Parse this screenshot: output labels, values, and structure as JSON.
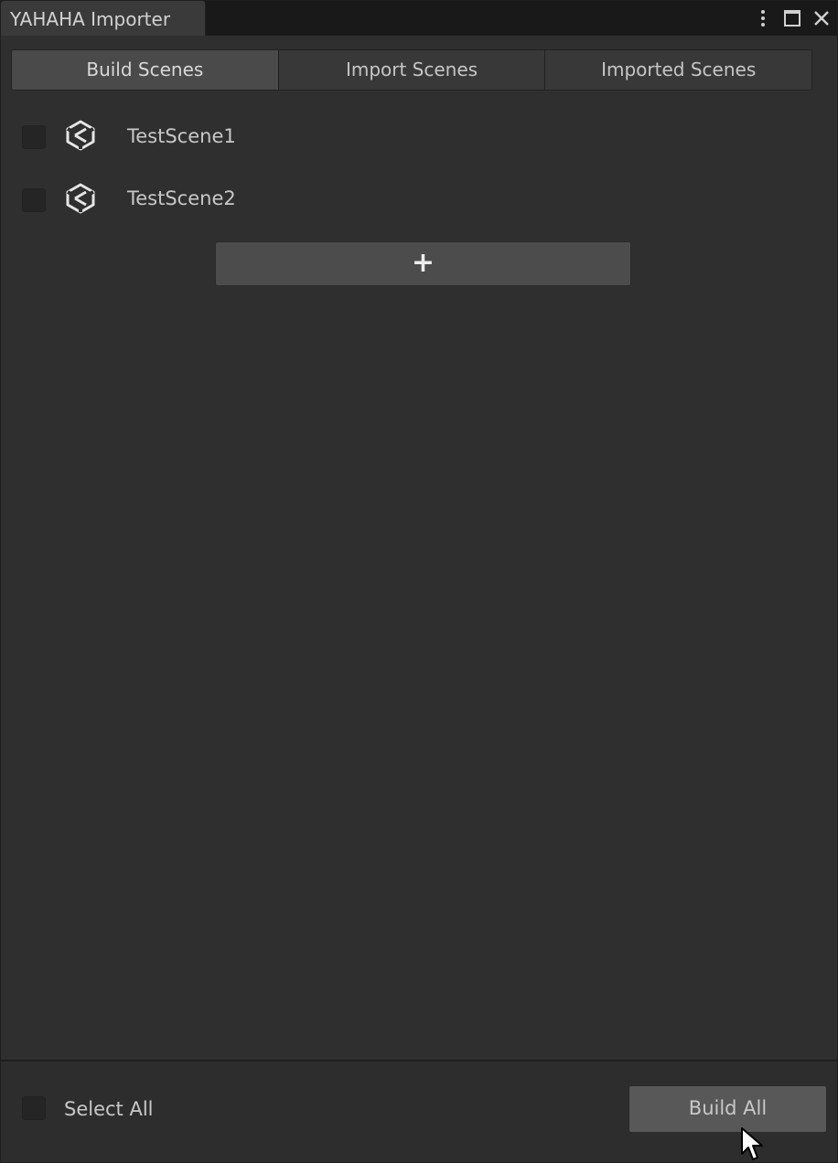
{
  "window": {
    "title": "YAHAHA Importer",
    "icons": [
      "more-vertical-icon",
      "maximize-icon",
      "close-icon"
    ]
  },
  "tabs": [
    {
      "label": "Build Scenes",
      "active": true
    },
    {
      "label": "Import Scenes",
      "active": false
    },
    {
      "label": "Imported Scenes",
      "active": false
    }
  ],
  "scenes": [
    {
      "name": "TestScene1",
      "checked": false,
      "icon": "unity-icon"
    },
    {
      "name": "TestScene2",
      "checked": false,
      "icon": "unity-icon"
    }
  ],
  "add_button": {
    "label": "+"
  },
  "footer": {
    "select_all_label": "Select All",
    "select_all_checked": false,
    "build_all_label": "Build All"
  },
  "colors": {
    "panel_bg": "#2f2f2f",
    "titlebar_bg": "#191919",
    "active_tab": "#4a4a4a",
    "button_bg": "#4c4c4c",
    "text": "#c4c4c4"
  }
}
